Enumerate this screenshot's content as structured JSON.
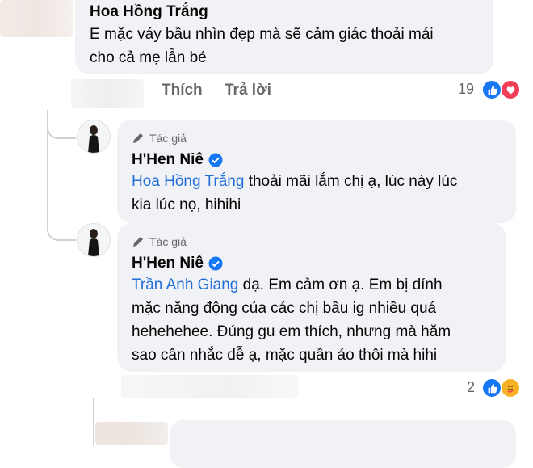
{
  "comment1": {
    "author": "Hoa Hồng Trắng",
    "line1": "E mặc váy bầu nhìn đẹp mà sẽ cảm giác thoải mái",
    "line2": "cho cả mẹ lẫn bé",
    "like_label": "Thích",
    "reply_label": "Trả lời",
    "reaction_count": "19",
    "reactions": [
      "like-icon",
      "love-icon"
    ]
  },
  "reply1": {
    "badge": "Tác giả",
    "author": "H'Hen Niê",
    "mention": "Hoa Hồng Trắng",
    "line1_rest": " thoải mãi lắm chị ạ, lúc này lúc",
    "line2": "kia lúc nọ, hihihi"
  },
  "reply2": {
    "badge": "Tác giả",
    "author": "H'Hen Niê",
    "mention": "Trần Anh Giang",
    "line1_rest": " dạ. Em cảm ơn ạ. Em bị dính",
    "line2": "mặc năng động của các chị bầu ig nhiều quá",
    "line3": "hehehehee. Đúng gu em thích, nhưng mà hăm",
    "line4": "sao cân nhắc dễ ạ, mặc quần áo thôi mà hihi",
    "reaction_count": "2",
    "reactions": [
      "like-icon",
      "care-icon"
    ]
  },
  "colors": {
    "bubble": "#f0f2f5",
    "mention": "#216fdb",
    "like_blue": "#1877f2",
    "love_red": "#f33e58",
    "care_yellow": "#f7b125",
    "verified": "#1877f2"
  }
}
